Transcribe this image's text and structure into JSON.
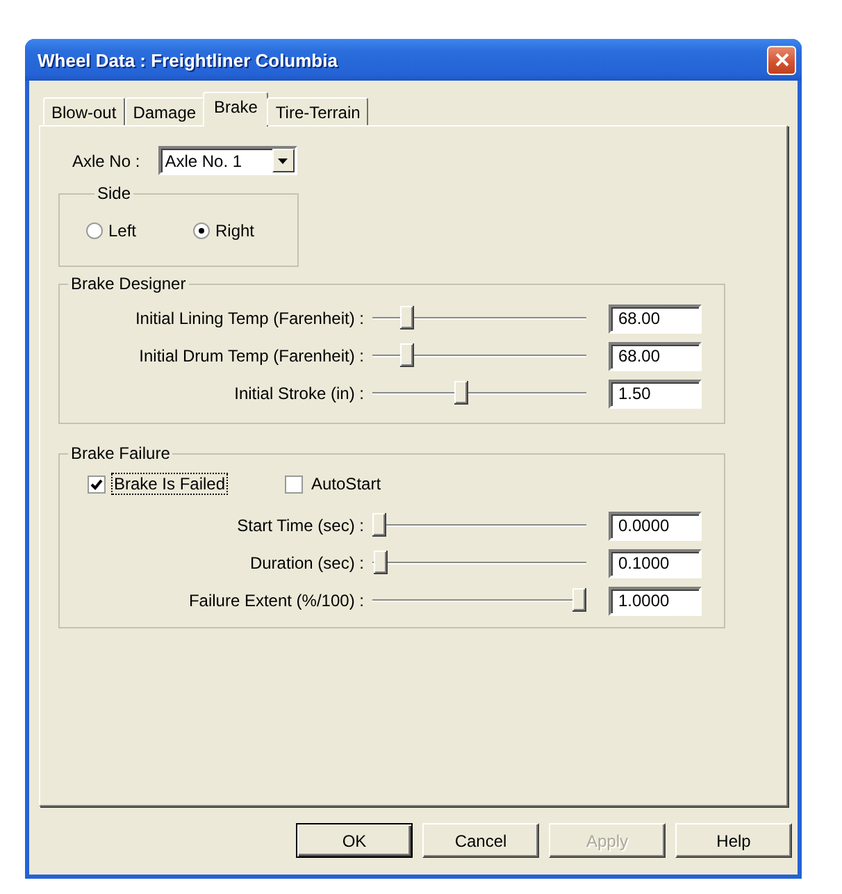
{
  "window": {
    "title": "Wheel Data : Freightliner Columbia"
  },
  "tabs": [
    {
      "label": "Blow-out",
      "selected": false
    },
    {
      "label": "Damage",
      "selected": false
    },
    {
      "label": "Brake",
      "selected": true
    },
    {
      "label": "Tire-Terrain",
      "selected": false
    }
  ],
  "axle": {
    "label": "Axle No :",
    "value": "Axle No. 1"
  },
  "side": {
    "title": "Side",
    "options": [
      {
        "label": "Left",
        "selected": false
      },
      {
        "label": "Right",
        "selected": true
      }
    ]
  },
  "brake_designer": {
    "title": "Brake Designer",
    "rows": [
      {
        "label": "Initial Lining Temp (Farenheit) :",
        "level": 0.14,
        "value": "68.00"
      },
      {
        "label": "Initial Drum Temp (Farenheit) :",
        "level": 0.14,
        "value": "68.00"
      },
      {
        "label": "Initial Stroke (in) :",
        "level": 0.41,
        "value": "1.50"
      }
    ]
  },
  "brake_failure": {
    "title": "Brake Failure",
    "checkboxes": [
      {
        "label": "Brake Is Failed",
        "checked": true,
        "focused": true
      },
      {
        "label": "AutoStart",
        "checked": false,
        "focused": false
      }
    ],
    "rows": [
      {
        "label": "Start Time (sec) :",
        "level": 0,
        "value": "0.0000"
      },
      {
        "label": "Duration (sec) :",
        "level": 0.01,
        "value": "0.1000"
      },
      {
        "label": "Failure Extent (%/100) :",
        "level": 1,
        "value": "1.0000"
      }
    ]
  },
  "buttons": [
    {
      "label": "OK",
      "default": true,
      "disabled": false
    },
    {
      "label": "Cancel",
      "default": false,
      "disabled": false
    },
    {
      "label": "Apply",
      "default": false,
      "disabled": true
    },
    {
      "label": "Help",
      "default": false,
      "disabled": false
    }
  ]
}
